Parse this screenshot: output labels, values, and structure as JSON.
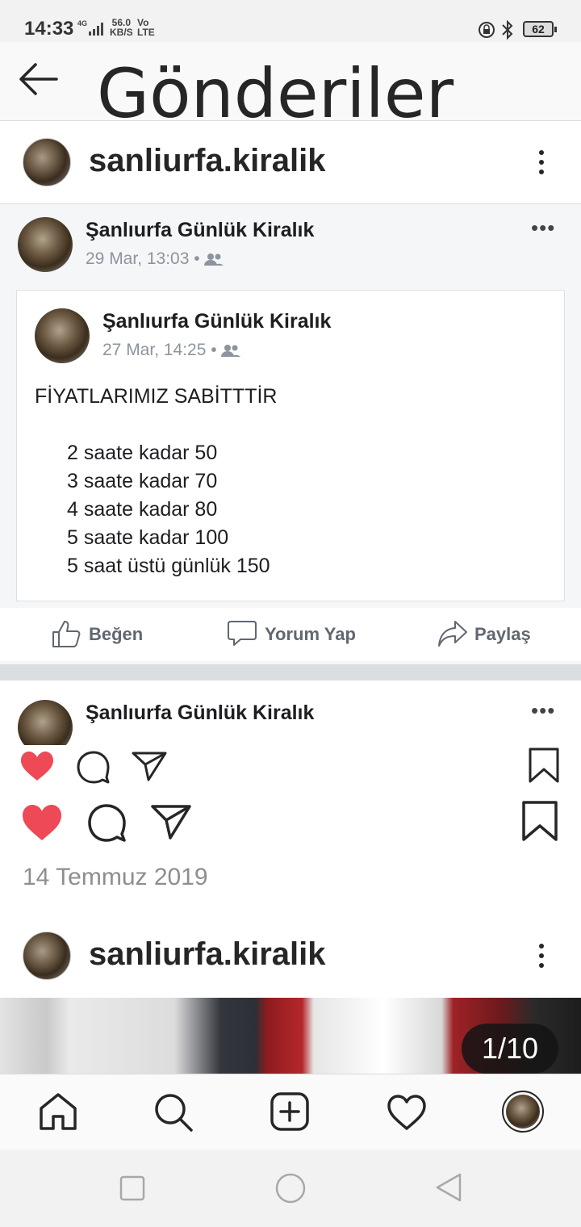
{
  "status_bar": {
    "time": "14:33",
    "network": "4G",
    "speed_value": "56.0",
    "speed_unit": "KB/S",
    "volte_top": "Vo",
    "volte_bottom": "LTE",
    "battery": "62"
  },
  "header": {
    "title": "Gönderiler",
    "back_icon": "arrow-left-icon"
  },
  "post1": {
    "username": "sanliurfa.kiralik",
    "screenshot": {
      "outer_author": "Şanlıurfa Günlük Kiralık",
      "outer_time": "29 Mar, 13:03 •",
      "inner_author": "Şanlıurfa Günlük Kiralık",
      "inner_time": "27 Mar, 14:25 •",
      "body_title": "FİYATLARIMIZ SABİTTTİR",
      "body_lines": [
        "2 saate kadar 50",
        "3 saate kadar 70",
        "4 saate kadar 80",
        "5 saate kadar 100",
        "5 saat üstü günlük 150"
      ],
      "actions": {
        "like": "Beğen",
        "comment": "Yorum Yap",
        "share": "Paylaş"
      },
      "next_author": "Şanlıurfa Günlük Kiralık"
    },
    "date": "14 Temmuz 2019"
  },
  "post2": {
    "username": "sanliurfa.kiralik",
    "counter": "1/10"
  },
  "colors": {
    "like_red": "#ed4956",
    "text": "#262626",
    "muted": "#8e8e8e"
  },
  "tabbar_icons": [
    "home-icon",
    "search-icon",
    "add-post-icon",
    "heart-icon",
    "profile-avatar"
  ],
  "system_nav_icons": [
    "recents-square-icon",
    "home-circle-icon",
    "back-triangle-icon"
  ]
}
